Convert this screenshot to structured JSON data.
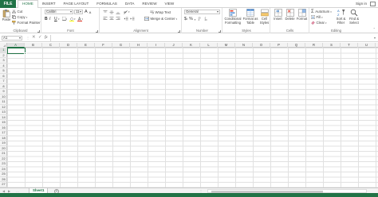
{
  "ribbon_tabs": {
    "file": "FILE",
    "tabs": [
      "HOME",
      "INSERT",
      "PAGE LAYOUT",
      "FORMULAS",
      "DATA",
      "REVIEW",
      "VIEW"
    ],
    "active_index": 0,
    "sign_in": "Sign in"
  },
  "clipboard": {
    "paste": "Paste",
    "cut": "Cut",
    "copy": "Copy",
    "format_painter": "Format Painter",
    "label": "Clipboard"
  },
  "font": {
    "name": "Calibri",
    "size": "11",
    "bold": "B",
    "italic": "I",
    "underline": "U",
    "grow": "A",
    "shrink": "A",
    "label": "Font"
  },
  "alignment": {
    "wrap_text": "Wrap Text",
    "merge_center": "Merge & Center",
    "label": "Alignment"
  },
  "number": {
    "format": "General",
    "currency": "$",
    "percent": "%",
    "comma": ",",
    "label": "Number"
  },
  "styles": {
    "conditional": "Conditional Formatting",
    "format_table": "Format as Table",
    "cell_styles": "Cell Styles",
    "label": "Styles"
  },
  "cells_group": {
    "insert": "Insert",
    "delete": "Delete",
    "format": "Format",
    "label": "Cells"
  },
  "editing": {
    "autosum": "AutoSum",
    "fill": "Fill",
    "clear": "Clear",
    "sort_filter": "Sort & Filter",
    "find_select": "Find & Select",
    "label": "Editing"
  },
  "formula_bar": {
    "name_box": "A1",
    "fx": "fx",
    "cancel": "✕",
    "enter": "✓"
  },
  "grid": {
    "columns": [
      "A",
      "B",
      "C",
      "D",
      "E",
      "F",
      "G",
      "H",
      "I",
      "J",
      "K",
      "L",
      "M",
      "N",
      "O",
      "P",
      "Q",
      "R",
      "S",
      "T",
      "U"
    ],
    "rows": [
      "1",
      "2",
      "3",
      "4",
      "5",
      "6",
      "7",
      "8",
      "9",
      "10",
      "11",
      "12",
      "13",
      "14",
      "15",
      "16",
      "17",
      "18",
      "19",
      "20",
      "21",
      "22",
      "23",
      "24",
      "25",
      "26",
      "27"
    ],
    "selected": "A1"
  },
  "sheets": {
    "tabs": [
      "Sheet1"
    ],
    "add": "+"
  },
  "colors": {
    "accent": "#217346",
    "gridline": "#e1e1e1",
    "header_bg": "#f3f3f3"
  }
}
